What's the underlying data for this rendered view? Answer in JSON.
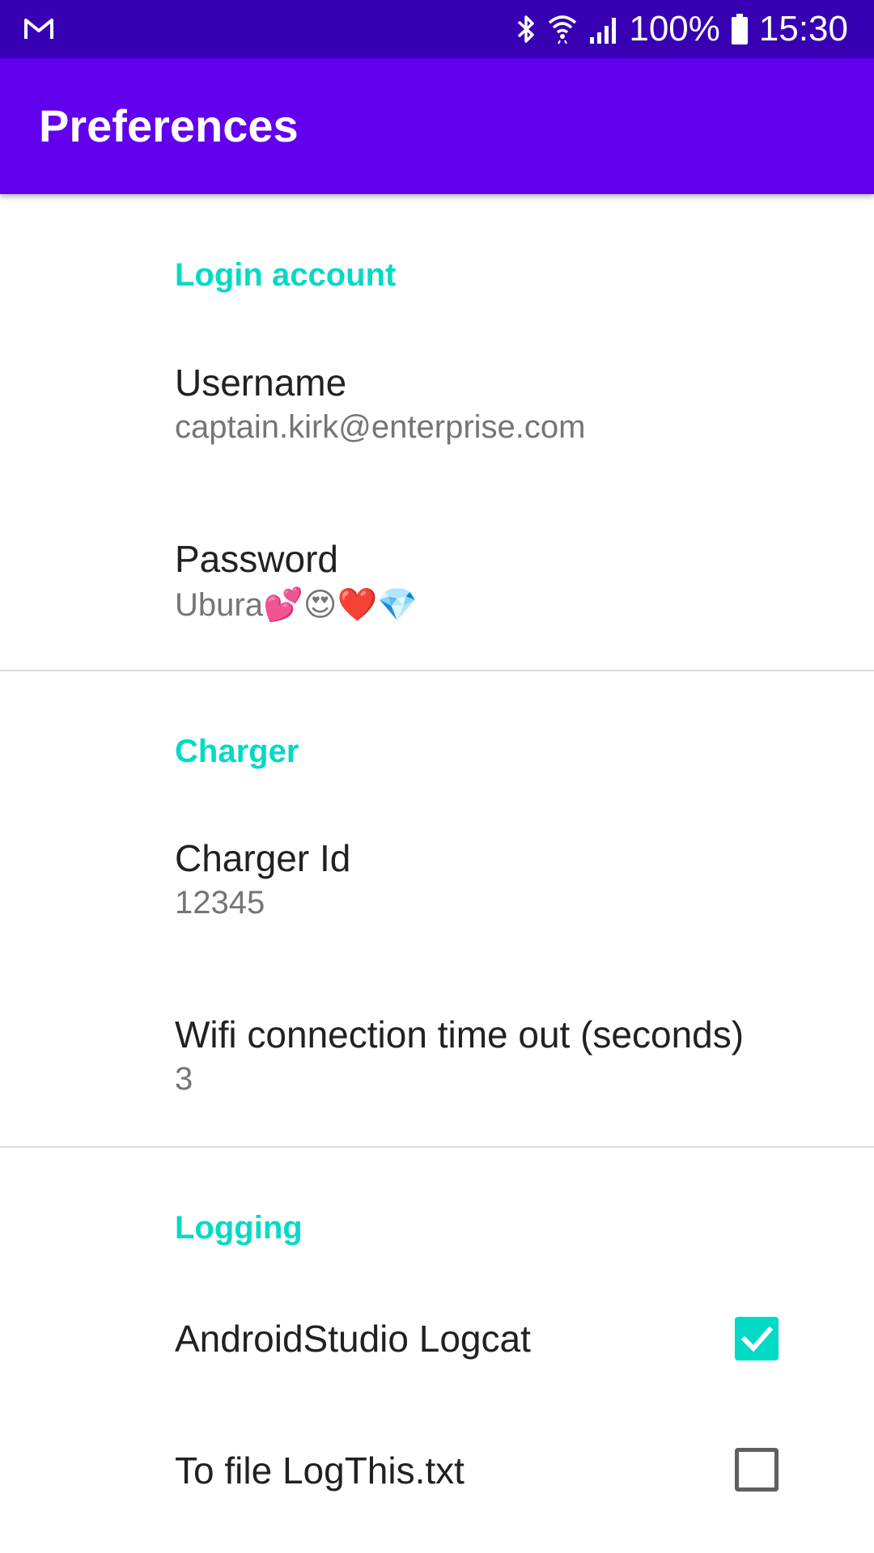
{
  "status_bar": {
    "battery_text": "100%",
    "time": "15:30",
    "icons": [
      "gmail-icon",
      "bluetooth-icon",
      "wifi-icon",
      "cell-signal-icon",
      "battery-icon"
    ]
  },
  "app_bar": {
    "title": "Preferences"
  },
  "categories": {
    "login": {
      "title": "Login account",
      "username": {
        "title": "Username",
        "summary": "captain.kirk@enterprise.com"
      },
      "password": {
        "title": "Password",
        "summary": "Ubura💕😍❤️💎"
      }
    },
    "charger": {
      "title": "Charger",
      "charger_id": {
        "title": "Charger Id",
        "summary": "12345"
      },
      "wifi_timeout": {
        "title": "Wifi connection time out (seconds)",
        "summary": "3"
      }
    },
    "logging": {
      "title": "Logging",
      "logcat": {
        "title": "AndroidStudio Logcat",
        "checked": true
      },
      "to_file": {
        "title": "To file LogThis.txt",
        "checked": false
      }
    }
  },
  "colors": {
    "status_bar": "#3700b3",
    "app_bar": "#6200ee",
    "accent": "#03dac5",
    "title_text": "#212121",
    "summary_text": "#757575"
  }
}
